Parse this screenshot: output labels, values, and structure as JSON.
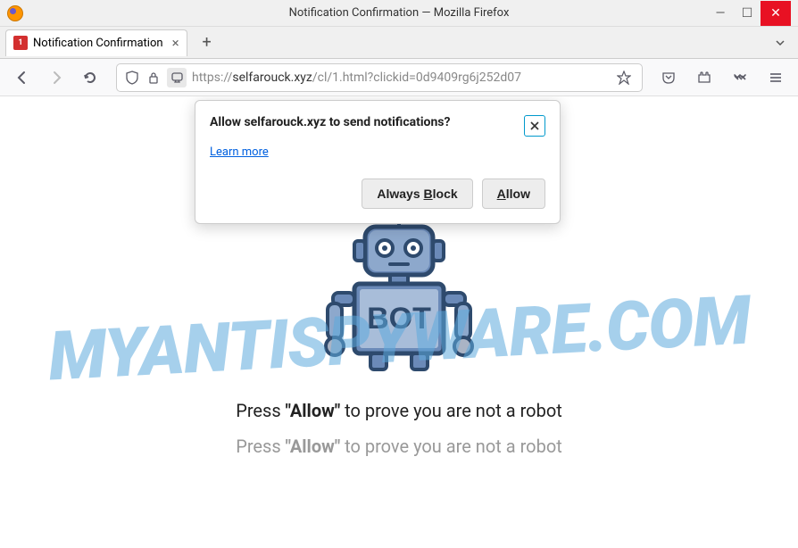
{
  "window": {
    "title": "Notification Confirmation — Mozilla Firefox"
  },
  "tab": {
    "favicon_badge": "1",
    "title": "Notification Confirmation"
  },
  "urlbar": {
    "scheme": "https://",
    "domain": "selfarouck.xyz",
    "path": "/cl/1.html?clickid=0d9409rg6j252d07"
  },
  "permission_popup": {
    "title": "Allow selfarouck.xyz to send notifications?",
    "learn_more": "Learn more",
    "always_block_pre": "Always ",
    "always_block_ul": "B",
    "always_block_post": "lock",
    "allow_ul": "A",
    "allow_post": "llow"
  },
  "page": {
    "bot_label": "BOT",
    "line1_pre": "Press ",
    "line1_bold": "\"Allow\"",
    "line1_post": " to prove you are not a robot",
    "line2_pre": "Press ",
    "line2_bold": "\"Allow\"",
    "line2_post": " to prove you are not a robot"
  },
  "watermark": "MYANTISPYWARE.COM"
}
